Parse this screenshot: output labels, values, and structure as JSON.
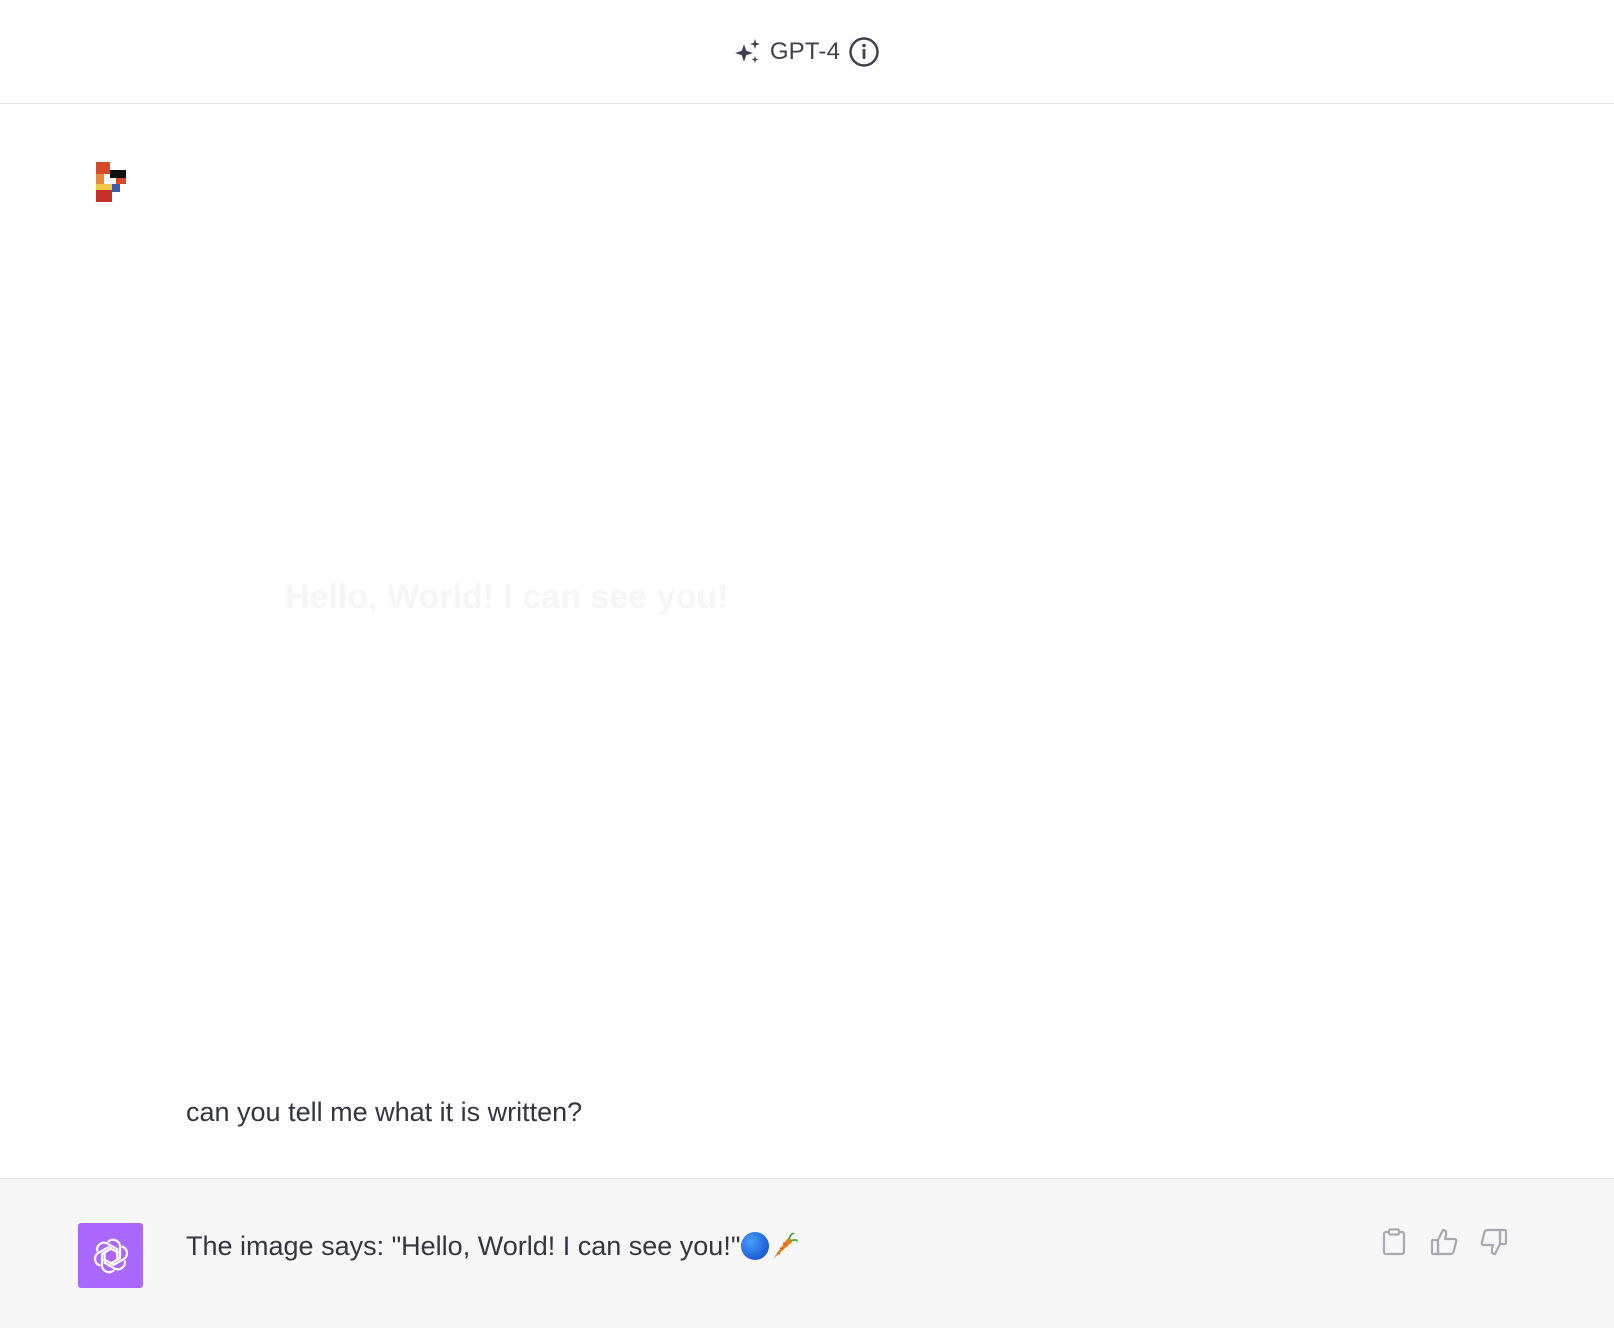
{
  "header": {
    "model_icon": "sparkles-icon",
    "model_name": "GPT-4",
    "info_icon": "info-icon"
  },
  "conversation": {
    "user_message": {
      "avatar": "user-avatar",
      "image_text": "Hello, World! I can see you!",
      "text": "can you tell me what it is written?"
    },
    "assistant_message": {
      "avatar": "openai-logo-icon",
      "accent_color": "#ab68ff",
      "text": "The image says: \"Hello, World! I can see you!\"",
      "emojis": [
        "blue-circle-emoji",
        "carrot-emoji"
      ],
      "actions": [
        "clipboard-icon",
        "thumbs-up-icon",
        "thumbs-down-icon"
      ]
    }
  },
  "colors": {
    "assistant_bg": "#f7f7f8",
    "text": "#343541",
    "border": "#e5e5e5"
  }
}
